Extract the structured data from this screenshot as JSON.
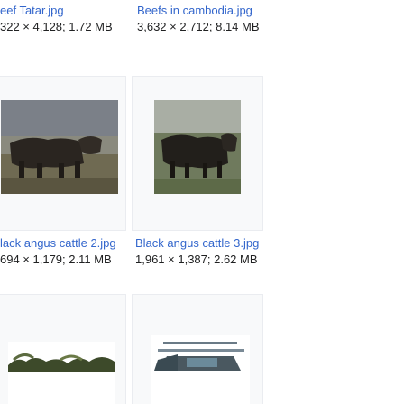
{
  "colors": {
    "link": "#3366cc",
    "meta": "#202122",
    "frame_bg": "#f8f9fa",
    "frame_border": "#eaecf0"
  },
  "gallery": {
    "row1": [
      {
        "name": "eef Tatar.jpg",
        "meta": "322 × 4,128; 1.72 MB"
      },
      {
        "name": "Beefs in cambodia.jpg",
        "meta": "3,632 × 2,712; 8.14 MB"
      }
    ],
    "row2": [
      {
        "name": "lack angus cattle 2.jpg",
        "meta": "694 × 1,179; 2.11 MB"
      },
      {
        "name": "Black angus cattle 3.jpg",
        "meta": "1,961 × 1,387; 2.62 MB"
      }
    ]
  }
}
